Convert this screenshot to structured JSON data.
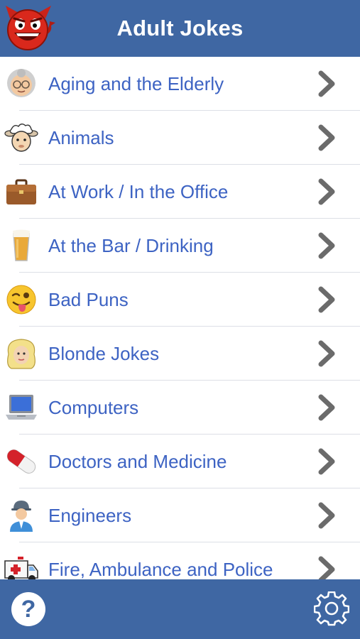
{
  "header": {
    "title": "Adult Jokes",
    "logo_icon": "devil-face-icon"
  },
  "categories": [
    {
      "label": "Aging and the Elderly",
      "icon": "grandmother-icon"
    },
    {
      "label": "Animals",
      "icon": "sheep-icon"
    },
    {
      "label": "At Work / In the Office",
      "icon": "briefcase-icon"
    },
    {
      "label": "At the Bar / Drinking",
      "icon": "beer-glass-icon"
    },
    {
      "label": "Bad Puns",
      "icon": "winking-tongue-face-icon"
    },
    {
      "label": "Blonde Jokes",
      "icon": "blonde-woman-icon"
    },
    {
      "label": "Computers",
      "icon": "laptop-icon"
    },
    {
      "label": "Doctors and Medicine",
      "icon": "pill-icon"
    },
    {
      "label": "Engineers",
      "icon": "engineer-icon"
    },
    {
      "label": "Fire, Ambulance and Police",
      "icon": "ambulance-icon"
    }
  ],
  "footer": {
    "help_label": "?",
    "help_icon": "help-icon",
    "settings_icon": "gear-icon"
  },
  "colors": {
    "bar": "#3f67a3",
    "label": "#3d63c3",
    "chevron": "#6b6b6b",
    "divider": "#dcdfe6"
  }
}
